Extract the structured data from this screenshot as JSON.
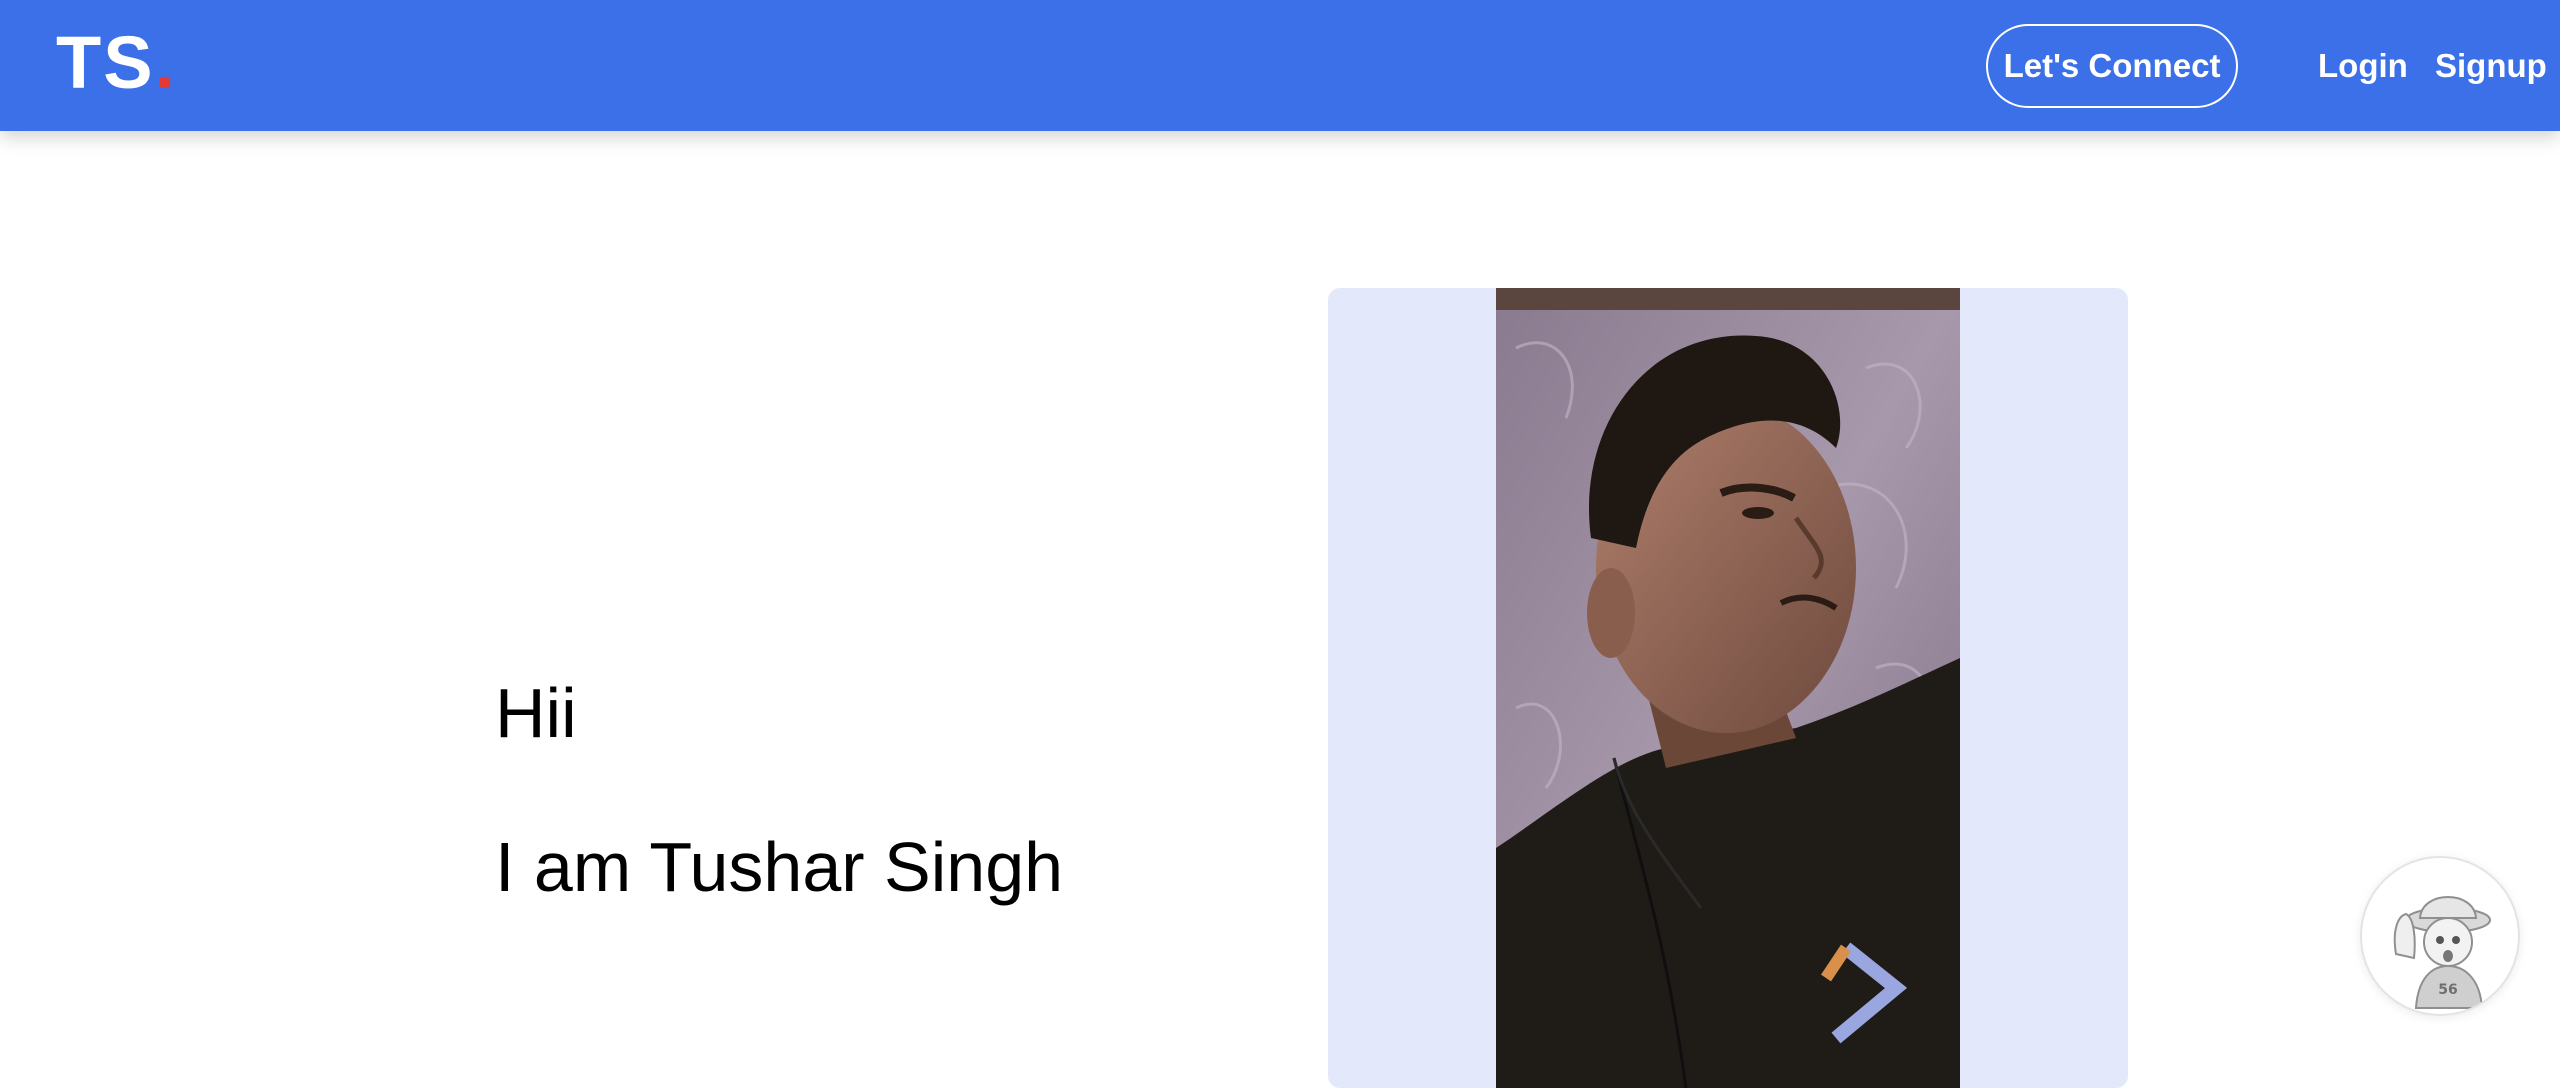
{
  "navbar": {
    "logo_text": "TS",
    "logo_dot": ".",
    "connect_label": "Let's Connect",
    "login_label": "Login",
    "signup_label": "Signup",
    "background_color": "#3b70e8",
    "logo_dot_color": "#e53935"
  },
  "hero": {
    "greeting": "Hii",
    "name_line": "I am Tushar Singh"
  },
  "photo": {
    "card_background": "#e3e8fb"
  },
  "chat_widget": {
    "icon": "anime-avatar-icon",
    "badge_text": "56"
  }
}
